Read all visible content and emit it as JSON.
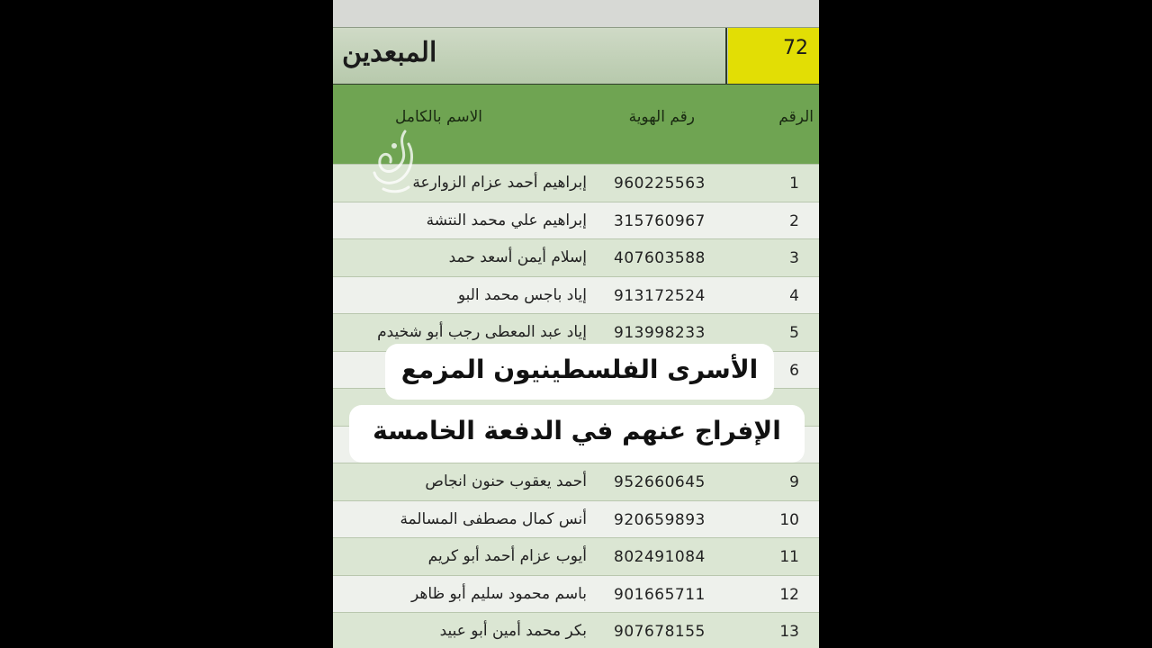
{
  "header": {
    "title": "المبعدين",
    "number": "72"
  },
  "columns": {
    "num": "الرقم",
    "id": "رقم الهوية",
    "name": "الاسم بالكامل"
  },
  "rows": [
    {
      "num": "1",
      "id": "960225563",
      "name": "إبراهيم أحمد عزام الزوارعة"
    },
    {
      "num": "2",
      "id": "315760967",
      "name": "إبراهيم علي محمد النتشة"
    },
    {
      "num": "3",
      "id": "407603588",
      "name": "إسلام أيمن أسعد حمد"
    },
    {
      "num": "4",
      "id": "913172524",
      "name": "إياد باجس محمد البو"
    },
    {
      "num": "5",
      "id": "913998233",
      "name": "إياد عبد المعطى رجب أبو شخيدم"
    },
    {
      "num": "6",
      "id": "",
      "name": ""
    },
    {
      "num": "",
      "id": "",
      "name": ""
    },
    {
      "num": "",
      "id": "",
      "name": ""
    },
    {
      "num": "9",
      "id": "952660645",
      "name": "أحمد يعقوب حنون انجاص"
    },
    {
      "num": "10",
      "id": "920659893",
      "name": "أنس كمال مصطفى المسالمة"
    },
    {
      "num": "11",
      "id": "802491084",
      "name": "أيوب عزام أحمد أبو كريم"
    },
    {
      "num": "12",
      "id": "901665711",
      "name": "باسم محمود سليم أبو ظاهر"
    },
    {
      "num": "13",
      "id": "907678155",
      "name": "بكر محمد أمين أبو عبيد"
    }
  ],
  "captions": {
    "line1": "الأسرى الفلسطينيون المزمع",
    "line2": "الإفراج عنهم في الدفعة الخامسة"
  },
  "logo": {
    "icon": "al-jazeera-logo-icon"
  }
}
